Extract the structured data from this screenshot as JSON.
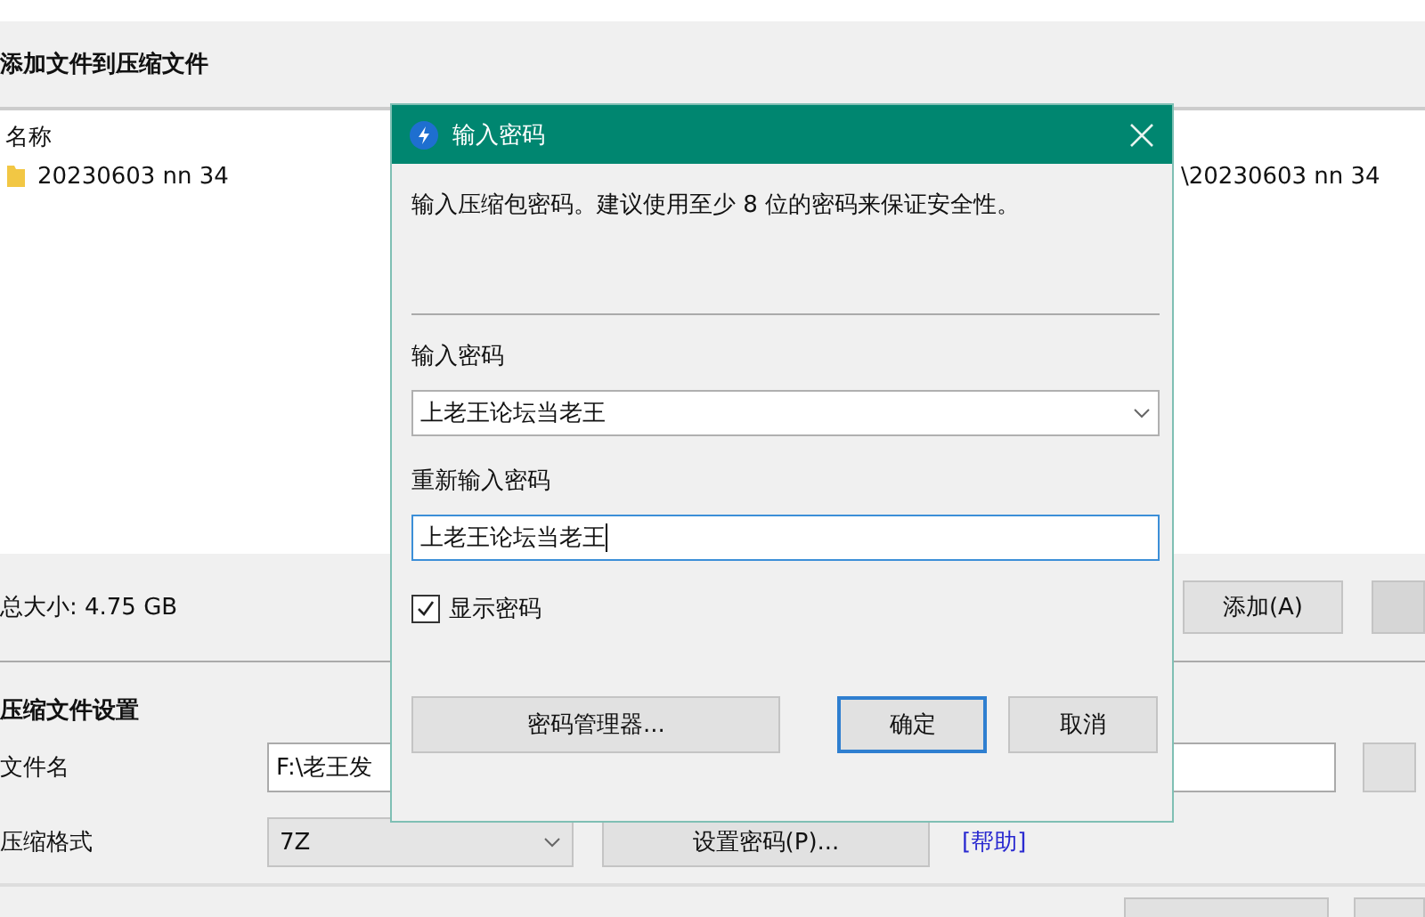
{
  "main": {
    "heading": "添加文件到压缩文件",
    "list": {
      "columns": [
        "名称"
      ],
      "rows": [
        {
          "name": "20230603 nn 34",
          "path": "\\20230603 nn 34"
        }
      ]
    },
    "total_size": "总大小: 4.75 GB",
    "add_button": "添加(A)",
    "settings_heading": "压缩文件设置",
    "filename_label": "文件名",
    "filename_value": "F:\\老王发",
    "format_label": "压缩格式",
    "format_value": "7Z",
    "set_password_button": "设置密码(P)...",
    "help_link": "[帮助]"
  },
  "dialog": {
    "title": "输入密码",
    "description": "输入压缩包密码。建议使用至少 8 位的密码来保证安全性。",
    "password_label": "输入密码",
    "password_value": "上老王论坛当老王",
    "repeat_label": "重新输入密码",
    "repeat_value": "上老王论坛当老王",
    "show_password": {
      "label": "显示密码",
      "checked": true
    },
    "manager_button": "密码管理器...",
    "ok_button": "确定",
    "cancel_button": "取消"
  }
}
